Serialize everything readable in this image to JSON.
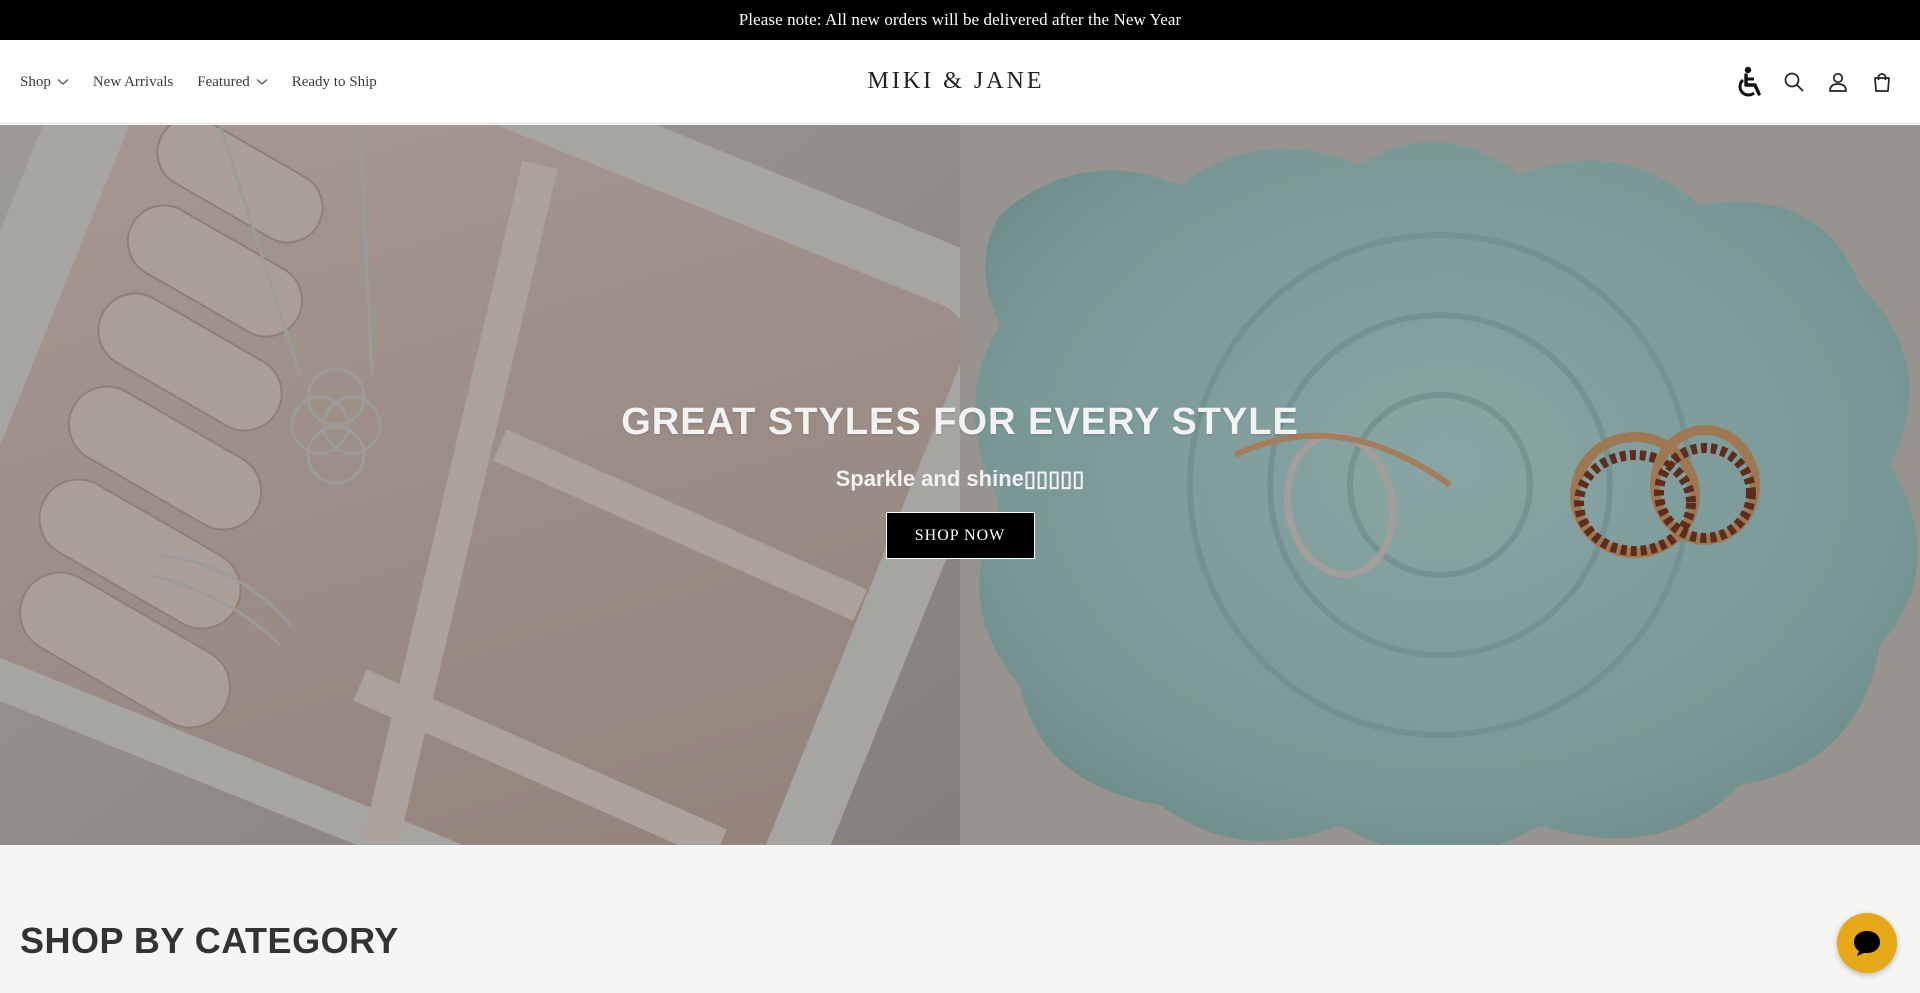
{
  "announcement": {
    "text": "Please note: All new orders will be delivered after the New Year"
  },
  "nav": {
    "items": [
      {
        "label": "Shop",
        "has_dropdown": true
      },
      {
        "label": "New Arrivals",
        "has_dropdown": false
      },
      {
        "label": "Featured",
        "has_dropdown": true
      },
      {
        "label": "Ready to Ship",
        "has_dropdown": false
      }
    ]
  },
  "brand": {
    "logo_text": "MIKI & JANE"
  },
  "header_icons": [
    "accessibility-icon",
    "search-icon",
    "account-icon",
    "cart-icon"
  ],
  "hero": {
    "title": "GREAT STYLES FOR EVERY STYLE",
    "subtitle": "Sparkle and shine▯▯▯▯▯",
    "button_label": "SHOP NOW"
  },
  "section": {
    "title": "SHOP BY CATEGORY"
  },
  "chat": {
    "icon": "chat-icon",
    "color": "#e6a817"
  },
  "colors": {
    "announcement_bg": "#000000",
    "button_bg": "#000000",
    "chat_bg": "#e6a817"
  }
}
